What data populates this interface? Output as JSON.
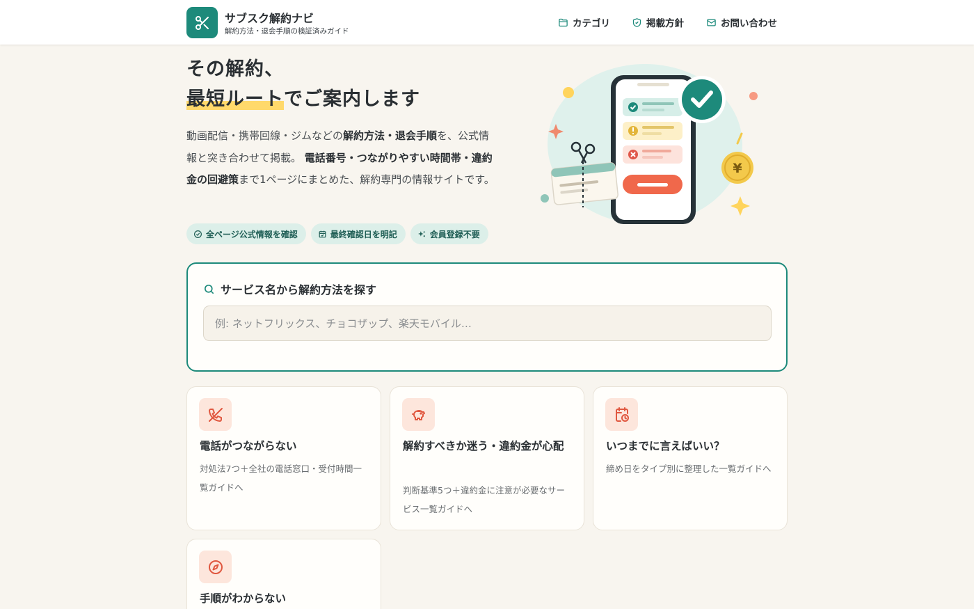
{
  "header": {
    "site_name": "サブスク解約ナビ",
    "tagline": "解約方法・退会手順の検証済みガイド",
    "nav": [
      {
        "label": "カテゴリ",
        "icon": "folder-icon"
      },
      {
        "label": "掲載方針",
        "icon": "shield-check-icon"
      },
      {
        "label": "お問い合わせ",
        "icon": "mail-icon"
      }
    ]
  },
  "hero": {
    "title_line1": "その解約、",
    "title_highlight": "最短ルート",
    "title_line2_rest": "でご案内します",
    "desc": {
      "p1": "動画配信・携帯回線・ジムなどの",
      "b1": "解約方法・退会手順",
      "p2": "を、公式情報と突き合わせて掲載。",
      "b2": "電話番号・つながりやすい時間帯・違約金の回避策",
      "p3": "まで1ページにまとめた、解約専門の情報サイトです。"
    },
    "badges": [
      {
        "label": "全ページ公式情報を確認",
        "icon": "check-circle-icon"
      },
      {
        "label": "最終確認日を明記",
        "icon": "calendar-check-icon"
      },
      {
        "label": "会員登録不要",
        "icon": "sparkle-icon"
      }
    ],
    "illustration_currency": "¥"
  },
  "search": {
    "heading": "サービス名から解約方法を探す",
    "placeholder": "例: ネットフリックス、チョコザップ、楽天モバイル…",
    "value": ""
  },
  "cards": [
    {
      "title": "電話がつながらない",
      "desc": "対処法7つ＋全社の電話窓口・受付時間一覧ガイドへ",
      "icon": "phone-off-icon"
    },
    {
      "title": "解約すべきか迷う・違約金が心配",
      "desc": "判断基準5つ＋違約金に注意が必要なサービス一覧ガイドへ",
      "icon": "piggy-bank-icon"
    },
    {
      "title": "いつまでに言えばいい？",
      "desc": "締め日をタイプ別に整理した一覧ガイドへ",
      "icon": "calendar-clock-icon"
    },
    {
      "title": "手順がわからない",
      "desc": "",
      "icon": "compass-icon"
    }
  ],
  "colors": {
    "brand": "#1d8a7b",
    "background": "#f8f5ef",
    "highlight": "#ffd96b",
    "accent": "#e8664a"
  }
}
